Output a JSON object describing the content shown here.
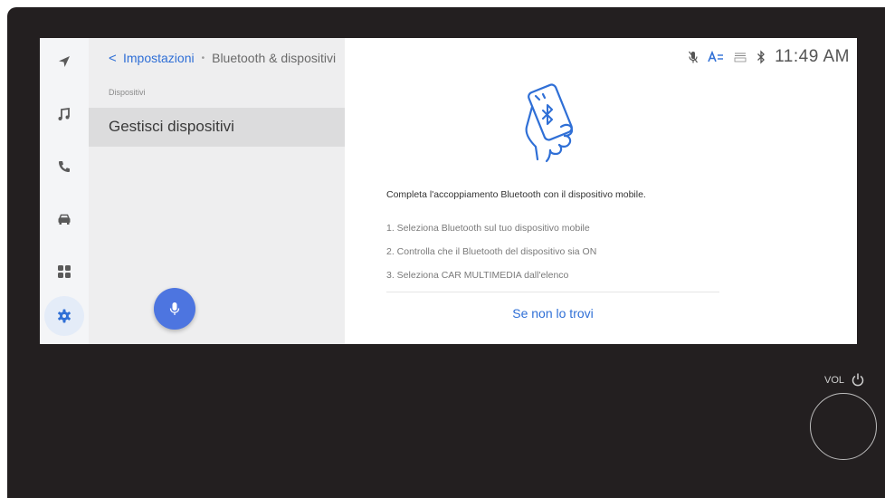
{
  "breadcrumb": {
    "back_icon": "chevron-left-icon",
    "parent": "Impostazioni",
    "separator": "•",
    "current": "Bluetooth & dispositivi"
  },
  "nav_rail": [
    {
      "icon": "navigation-arrow-icon",
      "active": false
    },
    {
      "icon": "music-note-icon",
      "active": false
    },
    {
      "icon": "phone-icon",
      "active": false
    },
    {
      "icon": "car-icon",
      "active": false
    },
    {
      "icon": "apps-grid-icon",
      "active": false
    },
    {
      "icon": "settings-gear-icon",
      "active": true
    }
  ],
  "left_panel": {
    "section_label": "Dispositivi",
    "items": [
      {
        "label": "Gestisci dispositivi",
        "selected": true
      }
    ]
  },
  "voice_button": {
    "icon": "microphone-icon"
  },
  "status_bar": {
    "icons": [
      "mic-off-icon",
      "font-size-icon",
      "dcm-icon",
      "bluetooth-icon"
    ],
    "time": "11:49 AM"
  },
  "main": {
    "illustration": "hand-holding-phone-bluetooth-icon",
    "title": "Completa l'accoppiamento Bluetooth con il dispositivo mobile.",
    "steps": [
      "1. Seleziona Bluetooth sul tuo dispositivo mobile",
      "2. Controlla che il Bluetooth del dispositivo sia ON",
      "3. Seleziona CAR MULTIMEDIA dall'elenco"
    ],
    "link": "Se non lo trovi"
  },
  "hardware": {
    "vol_label": "VOL"
  },
  "colors": {
    "accent": "#2f6fd6",
    "mic_button": "#4d75e0",
    "bezel": "#231f20",
    "nav_bg": "#f4f5f7",
    "panel_bg": "#eeeeef"
  }
}
